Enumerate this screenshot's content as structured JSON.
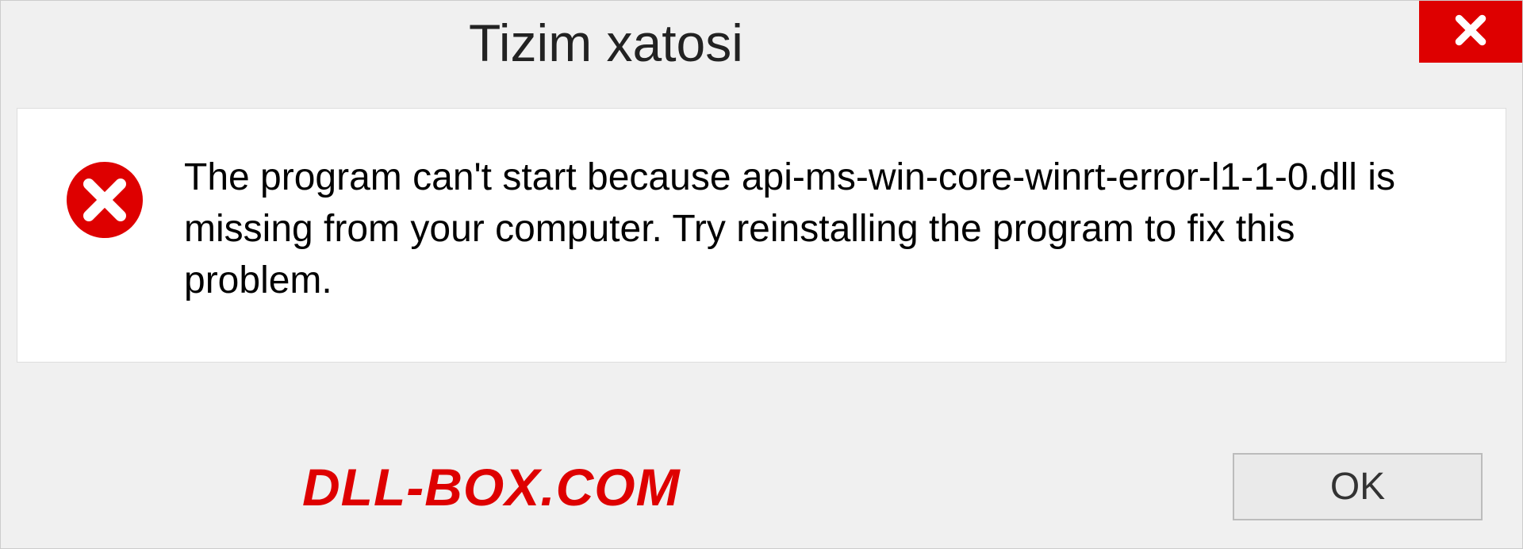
{
  "dialog": {
    "title": "Tizim xatosi",
    "message": "The program can't start because api-ms-win-core-winrt-error-l1-1-0.dll is missing from your computer. Try reinstalling the program to fix this problem.",
    "ok_label": "OK"
  },
  "watermark": "DLL-BOX.COM"
}
